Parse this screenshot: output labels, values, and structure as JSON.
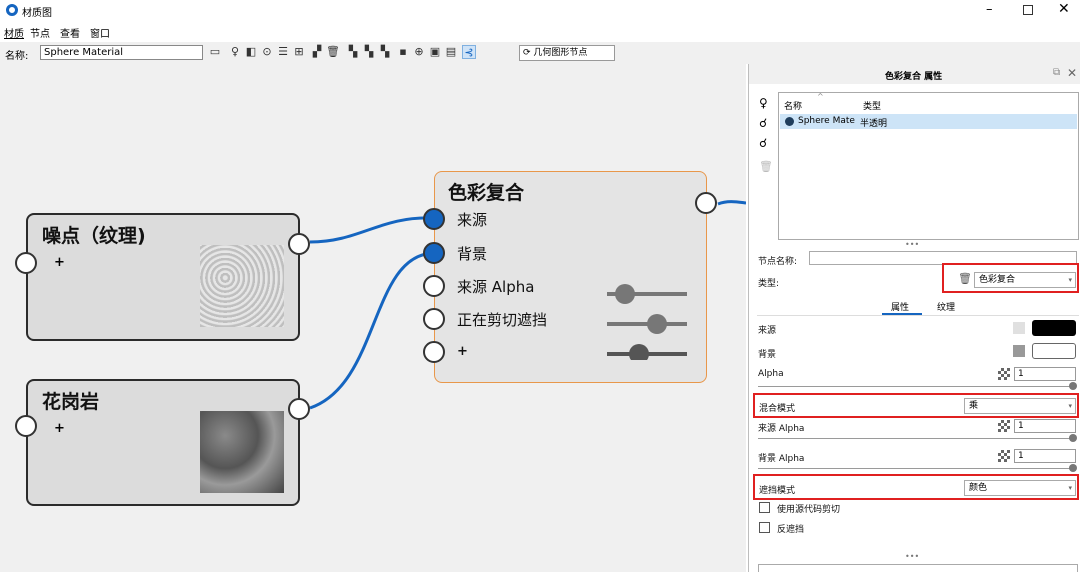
{
  "window": {
    "title": "材质图"
  },
  "menu": [
    "材质",
    "节点",
    "查看",
    "窗口"
  ],
  "toolbar": {
    "name_label": "名称:",
    "name_value": "Sphere Material",
    "geometry_button": "几何图形节点"
  },
  "nodes": {
    "noise": {
      "title": "噪点（纹理)",
      "add": "+"
    },
    "granite": {
      "title": "花岗岩",
      "add": "+"
    },
    "blend": {
      "title": "色彩复合",
      "inputs": [
        "来源",
        "背景",
        "来源 Alpha",
        "正在剪切遮挡",
        "+"
      ]
    }
  },
  "panel": {
    "header": "色彩复合 属性",
    "list": {
      "col_name": "名称",
      "col_type": "类型",
      "row_name": "Sphere Mate",
      "row_type": "半透明"
    },
    "more": "•••",
    "node_name_label": "节点名称:",
    "node_name_value": "",
    "type_label": "类型:",
    "type_value": "色彩复合",
    "tabs": [
      "属性",
      "纹理"
    ],
    "props": {
      "source": "来源",
      "background": "背景",
      "alpha": "Alpha",
      "alpha_value": "1",
      "blend_mode_label": "混合模式",
      "blend_mode_value": "乘",
      "source_alpha": "来源 Alpha",
      "source_alpha_value": "1",
      "bg_alpha": "背景 Alpha",
      "bg_alpha_value": "1",
      "occlusion_label": "遮挡模式",
      "occlusion_value": "颜色",
      "use_source_clip": "使用源代码剪切",
      "invert_occlusion": "反遮挡"
    },
    "more_bottom": "•••"
  },
  "colors": {
    "accent": "#1565c0",
    "highlight": "#e02020",
    "node_selected": "#e8974a"
  }
}
